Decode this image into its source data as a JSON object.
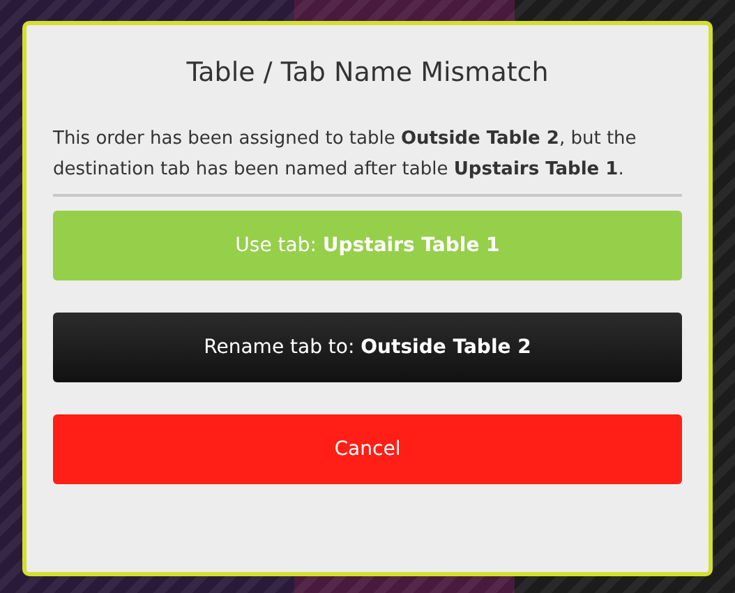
{
  "dialog": {
    "title": "Table / Tab Name Mismatch",
    "message": "This order has been assigned to table **Outside Table 2**, but the destination tab has been named after table **Upstairs Table 1**.",
    "buttons": [
      {
        "kind": "confirm",
        "label": "Use tab: **Upstairs Table 1**"
      },
      {
        "kind": "rename",
        "label": "Rename tab to: **Outside Table 2**"
      },
      {
        "kind": "cancel",
        "label": "Cancel"
      }
    ]
  }
}
